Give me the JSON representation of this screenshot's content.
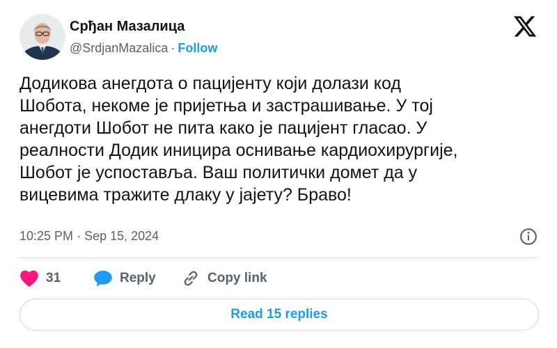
{
  "author": {
    "name": "Срђан Мазалица",
    "handle": "@SrdjanMazalica",
    "separator": "·",
    "follow_label": "Follow",
    "avatar_icon": "avatar-photo"
  },
  "tweet": {
    "text": "Додикова анегдота о пацијенту који долази код\nШобота, некоме је пријетња и застрашивање. У тој\nанегдоти Шобот не пита како је пацијент гласао. У\nреалности Додик иницира оснивање кардиохирургије,\nШобот је успоставља. Ваш политички домет да у\nвицевима тражите длаку у јајету? Браво!",
    "time": "10:25 PM",
    "date_separator": "·",
    "date": "Sep 15, 2024"
  },
  "actions": {
    "likes_count": "31",
    "reply_label": "Reply",
    "copy_link_label": "Copy link"
  },
  "read_replies_label": "Read 15 replies",
  "colors": {
    "accent": "#1d9bf0",
    "like": "#f91880",
    "text": "#0f1419",
    "muted": "#536471"
  },
  "icons": [
    "x-logo-icon",
    "info-icon",
    "heart-icon",
    "reply-bubble-icon",
    "link-icon"
  ]
}
